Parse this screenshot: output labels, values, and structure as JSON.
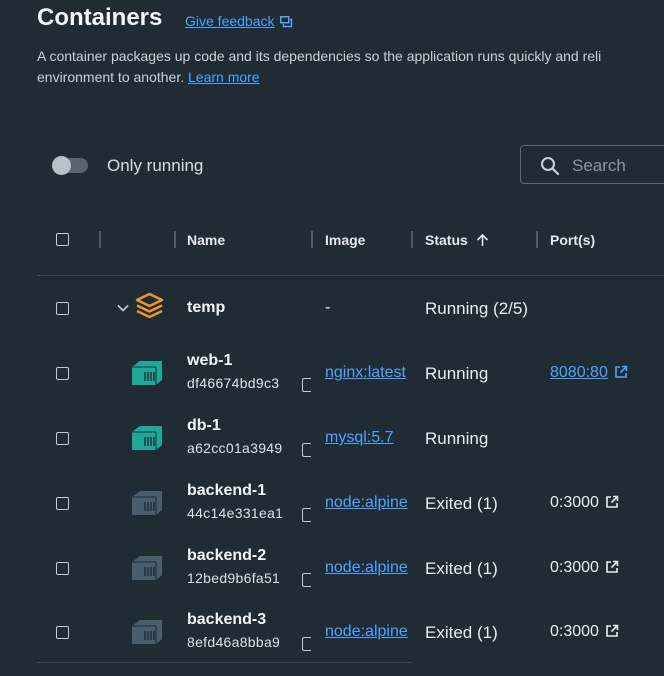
{
  "page": {
    "title": "Containers",
    "feedback_label": "Give feedback",
    "description_line1": "A container packages up code and its dependencies so the application runs quickly and reli",
    "description_line2": "environment to another.",
    "learn_more": "Learn more"
  },
  "filters": {
    "only_running_label": "Only running",
    "only_running_enabled": false,
    "search_placeholder": "Search"
  },
  "table": {
    "headers": {
      "name": "Name",
      "image": "Image",
      "status": "Status",
      "ports": "Port(s)"
    },
    "group": {
      "name": "temp",
      "image": "-",
      "status": "Running (2/5)"
    },
    "rows": [
      {
        "name": "web-1",
        "id": "df46674bd9c3",
        "image": "nginx:latest",
        "status": "Running",
        "port": "8080:80",
        "running": true
      },
      {
        "name": "db-1",
        "id": "a62cc01a3949",
        "image": "mysql:5.7",
        "status": "Running",
        "port": "",
        "running": true
      },
      {
        "name": "backend-1",
        "id": "44c14e331ea1",
        "image": "node:alpine",
        "status": "Exited (1)",
        "port": "0:3000",
        "running": false
      },
      {
        "name": "backend-2",
        "id": "12bed9b6fa51",
        "image": "node:alpine",
        "status": "Exited (1)",
        "port": "0:3000",
        "running": false
      },
      {
        "name": "backend-3",
        "id": "8efd46a8bba9",
        "image": "node:alpine",
        "status": "Exited (1)",
        "port": "0:3000",
        "running": false
      }
    ]
  },
  "colors": {
    "background": "#202c33",
    "link": "#4ea3ff",
    "running_container": "#1fa89a",
    "stopped_container": "#4a5d6c",
    "compose_stack": "#f0962e"
  }
}
